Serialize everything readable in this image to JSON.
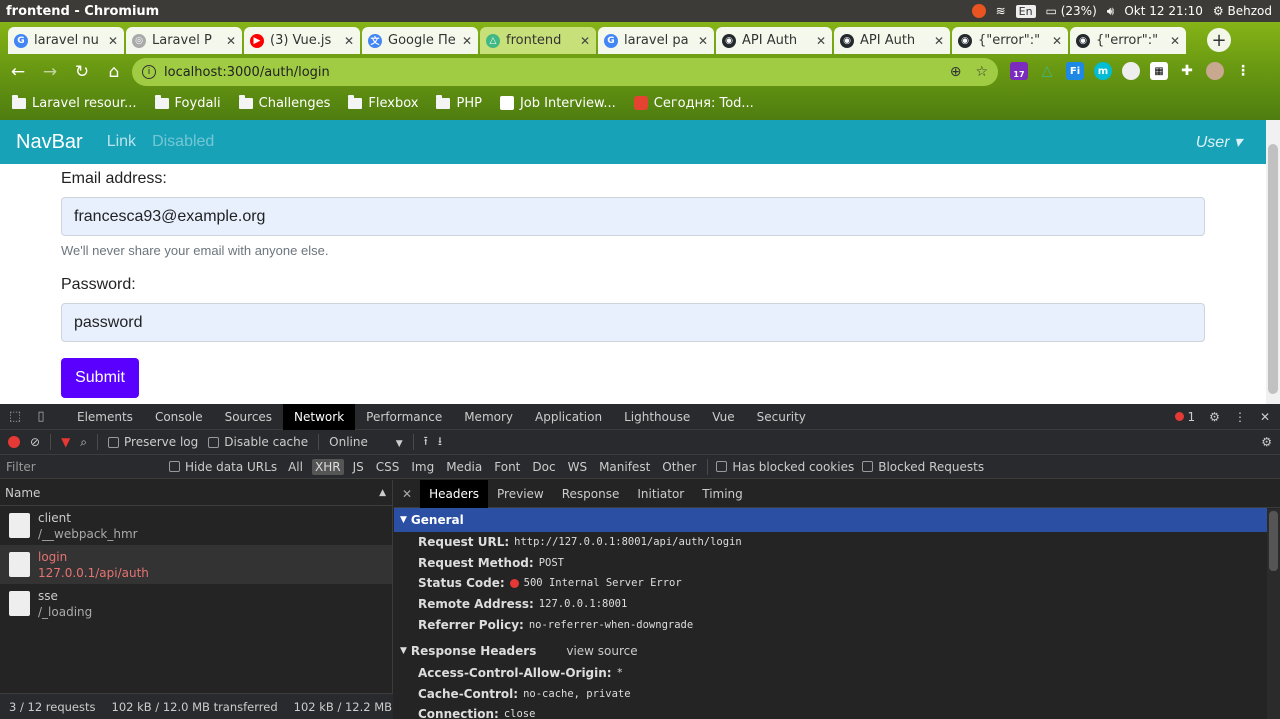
{
  "os": {
    "window_title": "frontend - Chromium",
    "battery": "(23%)",
    "keyboard": "En",
    "datetime": "Okt 12 21:10",
    "user": "Behzod"
  },
  "browser": {
    "tabs": [
      {
        "title": "laravel nu",
        "color": "#4285f4",
        "glyph": "G"
      },
      {
        "title": "Laravel P",
        "color": "#aaaaaa",
        "glyph": "◎"
      },
      {
        "title": "(3) Vue.js",
        "color": "#ff0000",
        "glyph": "▶"
      },
      {
        "title": "Google Пе",
        "color": "#4285f4",
        "glyph": "文"
      },
      {
        "title": "frontend",
        "color": "#41b883",
        "glyph": "△",
        "active": true
      },
      {
        "title": "laravel pa",
        "color": "#4285f4",
        "glyph": "G"
      },
      {
        "title": "API Auth",
        "color": "#24292e",
        "glyph": "◉"
      },
      {
        "title": "API Auth",
        "color": "#24292e",
        "glyph": "◉"
      },
      {
        "title": "{\"error\":\"",
        "color": "#24292e",
        "glyph": "◉"
      },
      {
        "title": "{\"error\":\"",
        "color": "#24292e",
        "glyph": "◉"
      }
    ],
    "url": "localhost:3000/auth/login",
    "extensions_badge": "17",
    "bookmarks": [
      {
        "label": "Laravel resour...",
        "type": "folder"
      },
      {
        "label": "Foydali",
        "type": "folder"
      },
      {
        "label": "Challenges",
        "type": "folder"
      },
      {
        "label": "Flexbox",
        "type": "folder"
      },
      {
        "label": "PHP",
        "type": "folder"
      },
      {
        "label": "Job Interview...",
        "type": "site"
      },
      {
        "label": "Сегодня: Tod...",
        "type": "todoist"
      }
    ]
  },
  "page": {
    "navbar": {
      "brand": "NavBar",
      "link": "Link",
      "disabled": "Disabled",
      "user": "User ▾"
    },
    "form": {
      "email_label": "Email address:",
      "email_value": "francesca93@example.org",
      "email_help": "We'll never share your email with anyone else.",
      "password_label": "Password:",
      "password_value": "password",
      "submit": "Submit"
    }
  },
  "devtools": {
    "tabs": [
      "Elements",
      "Console",
      "Sources",
      "Network",
      "Performance",
      "Memory",
      "Application",
      "Lighthouse",
      "Vue",
      "Security"
    ],
    "active_tab": "Network",
    "error_count": "1",
    "controls": {
      "preserve_log": "Preserve log",
      "disable_cache": "Disable cache",
      "throttle": "Online"
    },
    "filter": {
      "placeholder": "Filter",
      "hide_data_urls": "Hide data URLs",
      "types": [
        "All",
        "XHR",
        "JS",
        "CSS",
        "Img",
        "Media",
        "Font",
        "Doc",
        "WS",
        "Manifest",
        "Other"
      ],
      "selected_type": "XHR",
      "has_blocked_cookies": "Has blocked cookies",
      "blocked_requests": "Blocked Requests"
    },
    "requests_header": "Name",
    "requests": [
      {
        "name": "client",
        "path": "/__webpack_hmr",
        "error": false
      },
      {
        "name": "login",
        "path": "127.0.0.1/api/auth",
        "error": true
      },
      {
        "name": "sse",
        "path": "/_loading",
        "error": false
      }
    ],
    "footer": {
      "count": "3 / 12 requests",
      "transferred": "102 kB / 12.0 MB transferred",
      "resources": "102 kB / 12.2 MB resources"
    },
    "detail_tabs": [
      "Headers",
      "Preview",
      "Response",
      "Initiator",
      "Timing"
    ],
    "general_title": "General",
    "general": [
      {
        "key": "Request URL:",
        "value": "http://127.0.0.1:8001/api/auth/login"
      },
      {
        "key": "Request Method:",
        "value": "POST"
      },
      {
        "key": "Status Code:",
        "value": "500 Internal Server Error",
        "status_dot": true
      },
      {
        "key": "Remote Address:",
        "value": "127.0.0.1:8001"
      },
      {
        "key": "Referrer Policy:",
        "value": "no-referrer-when-downgrade"
      }
    ],
    "response_headers_title": "Response Headers",
    "view_source": "view source",
    "response_headers": [
      {
        "key": "Access-Control-Allow-Origin:",
        "value": "*"
      },
      {
        "key": "Cache-Control:",
        "value": "no-cache, private"
      },
      {
        "key": "Connection:",
        "value": "close"
      }
    ]
  }
}
